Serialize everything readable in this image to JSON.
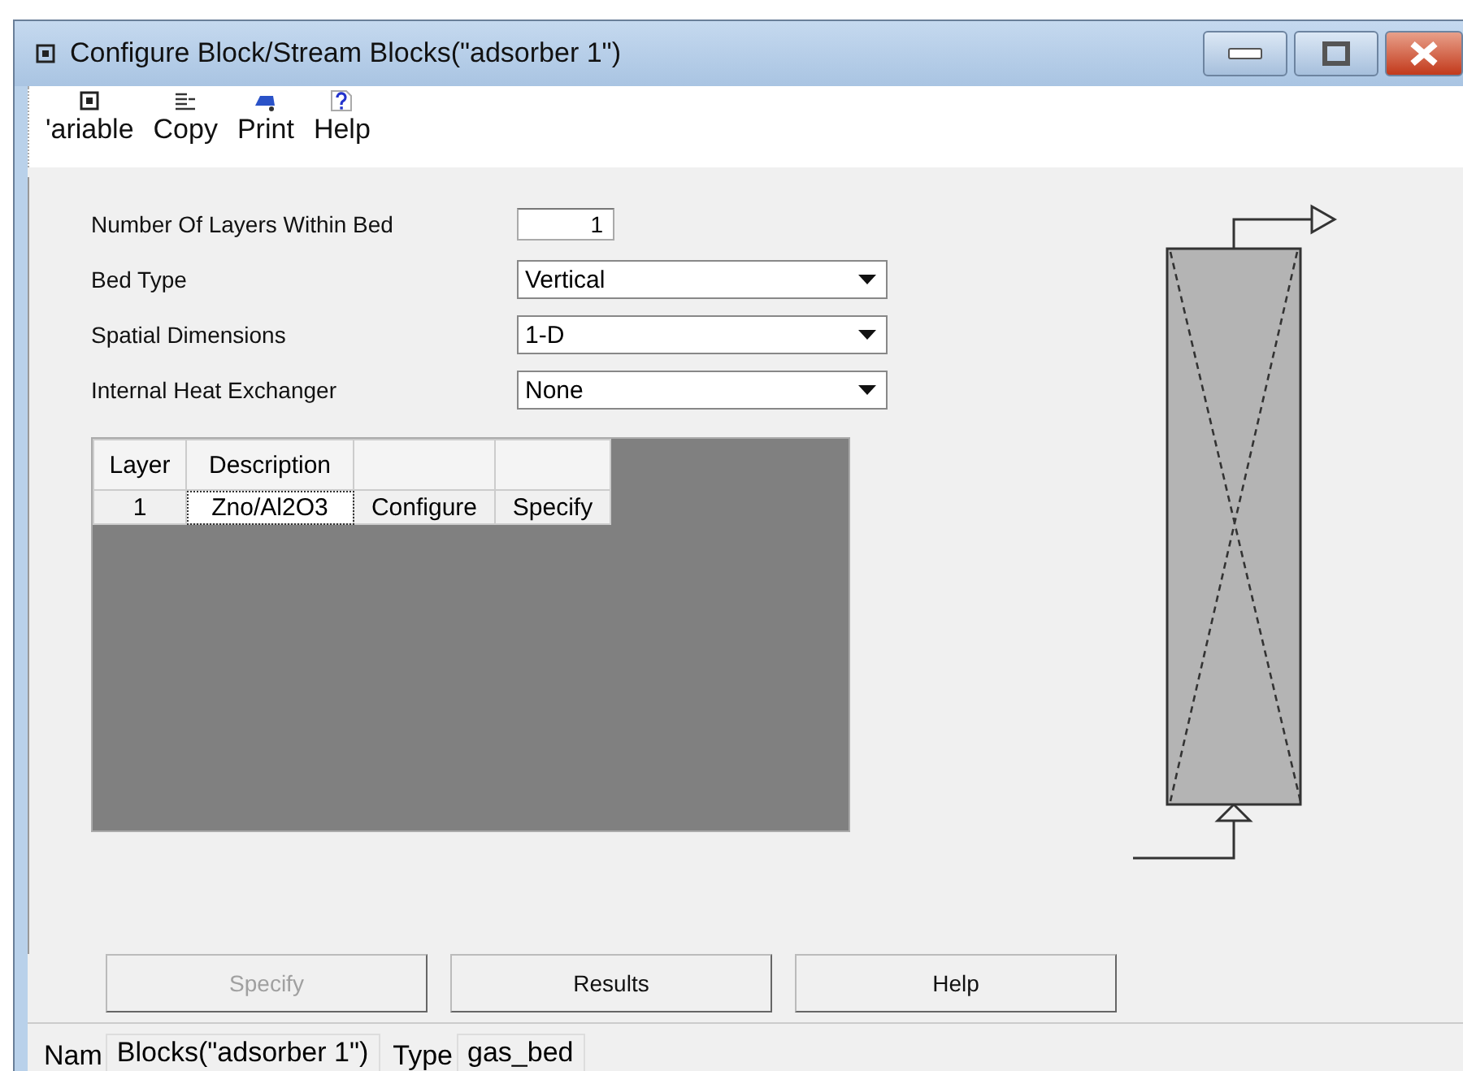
{
  "window": {
    "title": "Configure Block/Stream Blocks(\"adsorber 1\")"
  },
  "toolbar": [
    {
      "label": "'ariable"
    },
    {
      "label": "Copy"
    },
    {
      "label": "Print"
    },
    {
      "label": "Help"
    }
  ],
  "fields": [
    {
      "kind": "number",
      "label": "Number Of Layers Within Bed",
      "value": "1"
    },
    {
      "kind": "select",
      "label": "Bed Type",
      "value": "Vertical"
    },
    {
      "kind": "select",
      "label": "Spatial Dimensions",
      "value": "1-D"
    },
    {
      "kind": "select",
      "label": "Internal Heat Exchanger",
      "value": "None"
    }
  ],
  "table": {
    "columns": [
      "Layer",
      "Description",
      "",
      ""
    ],
    "rows": [
      {
        "cells": [
          {
            "text": "1",
            "selected": false
          },
          {
            "text": "Zno/Al2O3",
            "selected": true
          },
          {
            "text": "Configure",
            "selected": false
          },
          {
            "text": "Specify",
            "selected": false
          }
        ]
      }
    ]
  },
  "buttons": [
    {
      "label": "Specify",
      "disabled": true
    },
    {
      "label": "Results",
      "disabled": false
    },
    {
      "label": "Help",
      "disabled": false
    }
  ],
  "status_bar": {
    "name_label": "Nam",
    "name_value": "Blocks(\"adsorber 1\")",
    "type_label": "Type",
    "type_value": "gas_bed"
  }
}
